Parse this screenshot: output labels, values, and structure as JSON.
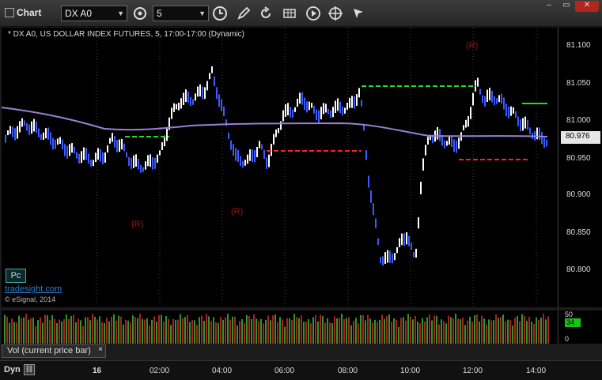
{
  "window": {
    "title": "Chart"
  },
  "toolbar": {
    "symbol": "DX A0",
    "interval": "5",
    "icons": [
      "clock-icon",
      "pencil-icon",
      "refresh-icon",
      "cube-icon",
      "play-icon",
      "cursor-icon",
      "settings-icon"
    ],
    "window_buttons": {
      "minimize": "–",
      "maximize": "▭",
      "close": "✕"
    }
  },
  "chart": {
    "title": "* DX A0, US DOLLAR INDEX FUTURES, 5, 17:00-17:00 (Dynamic)",
    "watermark": "tradesight.com",
    "copyright": "© eSignal, 2014",
    "pc_button": "Pc",
    "last_price": "80.976",
    "price_labels": [
      "81.100",
      "81.050",
      "81.000",
      "80.950",
      "80.900",
      "80.850",
      "80.800"
    ],
    "annotations_r": [
      "(R)",
      "(R)",
      "(R)"
    ]
  },
  "volume": {
    "tab_label": "Vol (current price bar)",
    "tab_close": "×",
    "axis_labels": [
      "50",
      "34",
      "0"
    ]
  },
  "time_axis": {
    "mode": "Dyn",
    "labels": [
      "16",
      "02:00",
      "04:00",
      "06:00",
      "08:00",
      "10:00",
      "12:00",
      "14:00"
    ]
  },
  "colors": {
    "up_bar": "#ffffff",
    "down_bar": "#3a5bff",
    "moving_average": "#9b7fd4",
    "support_red": "#ff2020",
    "resistance_green": "#22dd22",
    "count_yellow": "#e6e600",
    "count_green": "#2e8b2e",
    "count_magenta": "#ff33ff",
    "r_label": "#a01515"
  }
}
